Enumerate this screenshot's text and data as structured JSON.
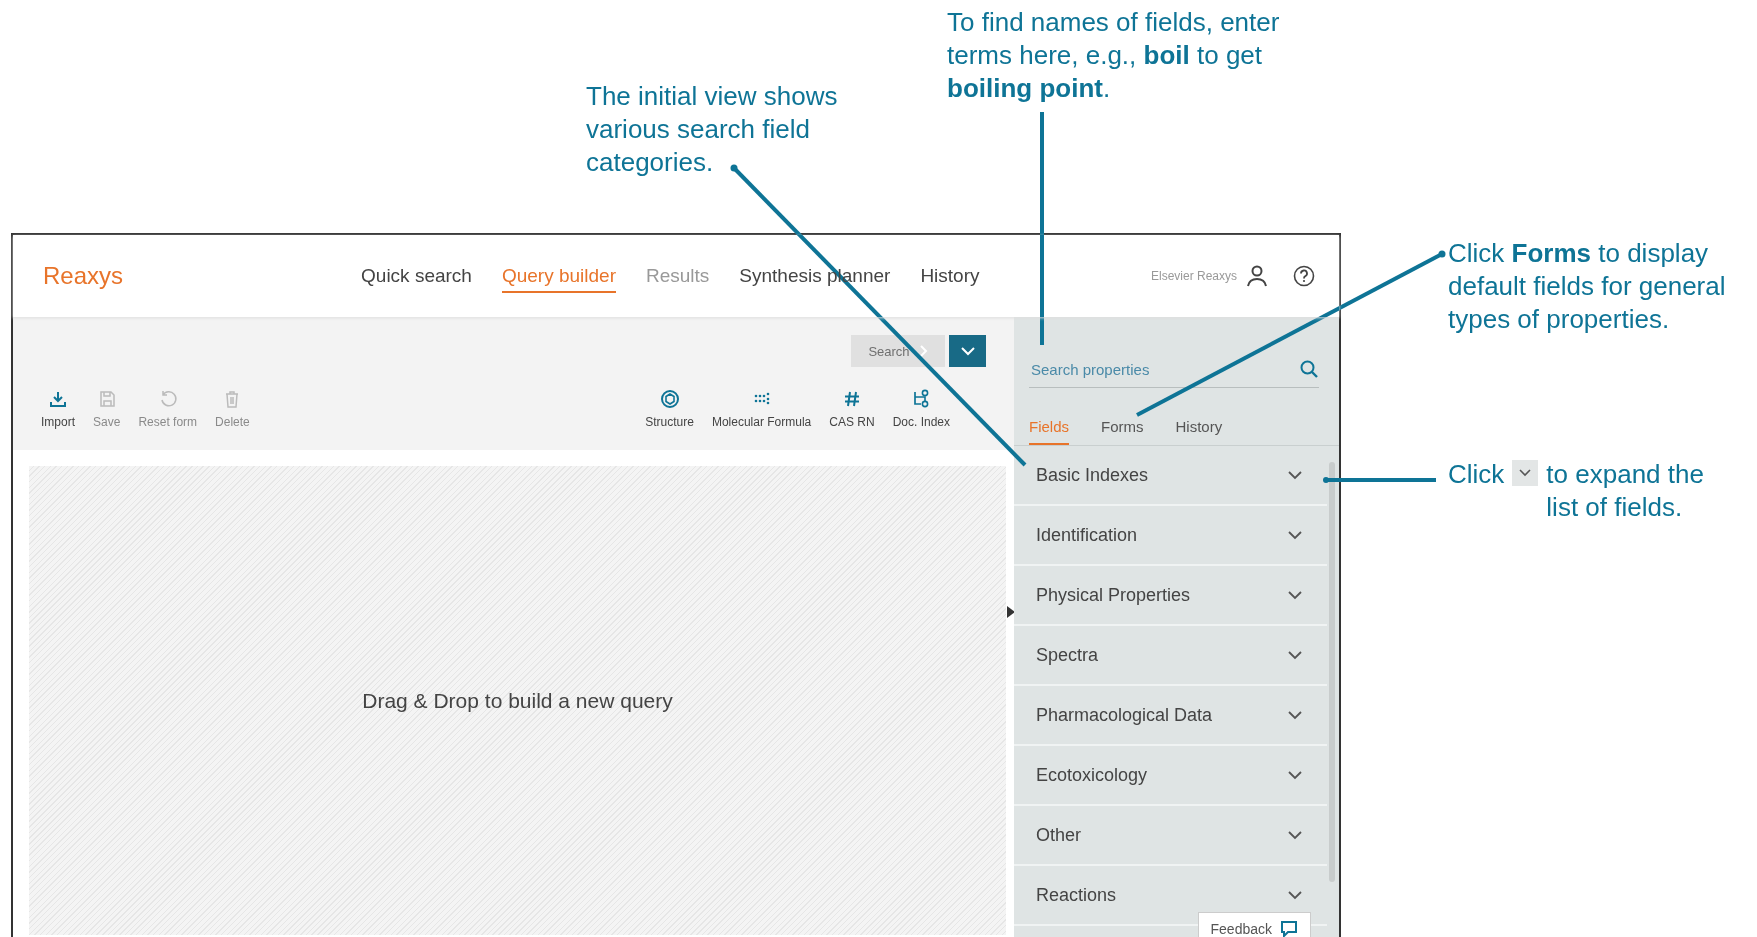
{
  "annotations": [
    {
      "text": "The initial view shows various search field categories."
    },
    {
      "text": "To find names of fields, enter terms here, e.g., **boil** to get **boiling point**."
    },
    {
      "text": "Click **Forms** to display default fields for general types of properties."
    }
  ],
  "expand_note": {
    "before": "Click",
    "after": "to expand the list of fields."
  },
  "app": {
    "logo": "Reaxys",
    "nav": [
      {
        "label": "Quick search",
        "selected": false,
        "disabled": false
      },
      {
        "label": "Query builder",
        "selected": true,
        "disabled": false
      },
      {
        "label": "Results",
        "selected": false,
        "disabled": true
      },
      {
        "label": "Synthesis planner",
        "selected": false,
        "disabled": false
      },
      {
        "label": "History",
        "selected": false,
        "disabled": false
      }
    ],
    "user": "Elsevier Reaxys",
    "search_button": {
      "label": "Search",
      "disabled": true
    },
    "tools_left": [
      {
        "label": "Import",
        "disabled": false
      },
      {
        "label": "Save",
        "disabled": true
      },
      {
        "label": "Reset form",
        "disabled": true
      },
      {
        "label": "Delete",
        "disabled": true
      }
    ],
    "tools_right": [
      {
        "label": "Structure"
      },
      {
        "label": "Molecular Formula"
      },
      {
        "label": "CAS RN"
      },
      {
        "label": "Doc. Index"
      }
    ],
    "canvas_hint": "Drag & Drop to build a new query",
    "properties_search": {
      "placeholder": "Search properties"
    },
    "panel_tabs": [
      {
        "label": "Fields",
        "selected": true
      },
      {
        "label": "Forms",
        "selected": false
      },
      {
        "label": "History",
        "selected": false
      }
    ],
    "categories": [
      {
        "label": "Basic Indexes"
      },
      {
        "label": "Identification"
      },
      {
        "label": "Physical Properties"
      },
      {
        "label": "Spectra"
      },
      {
        "label": "Pharmacological Data"
      },
      {
        "label": "Ecotoxicology"
      },
      {
        "label": "Other"
      },
      {
        "label": "Reactions"
      }
    ],
    "feedback": "Feedback"
  }
}
